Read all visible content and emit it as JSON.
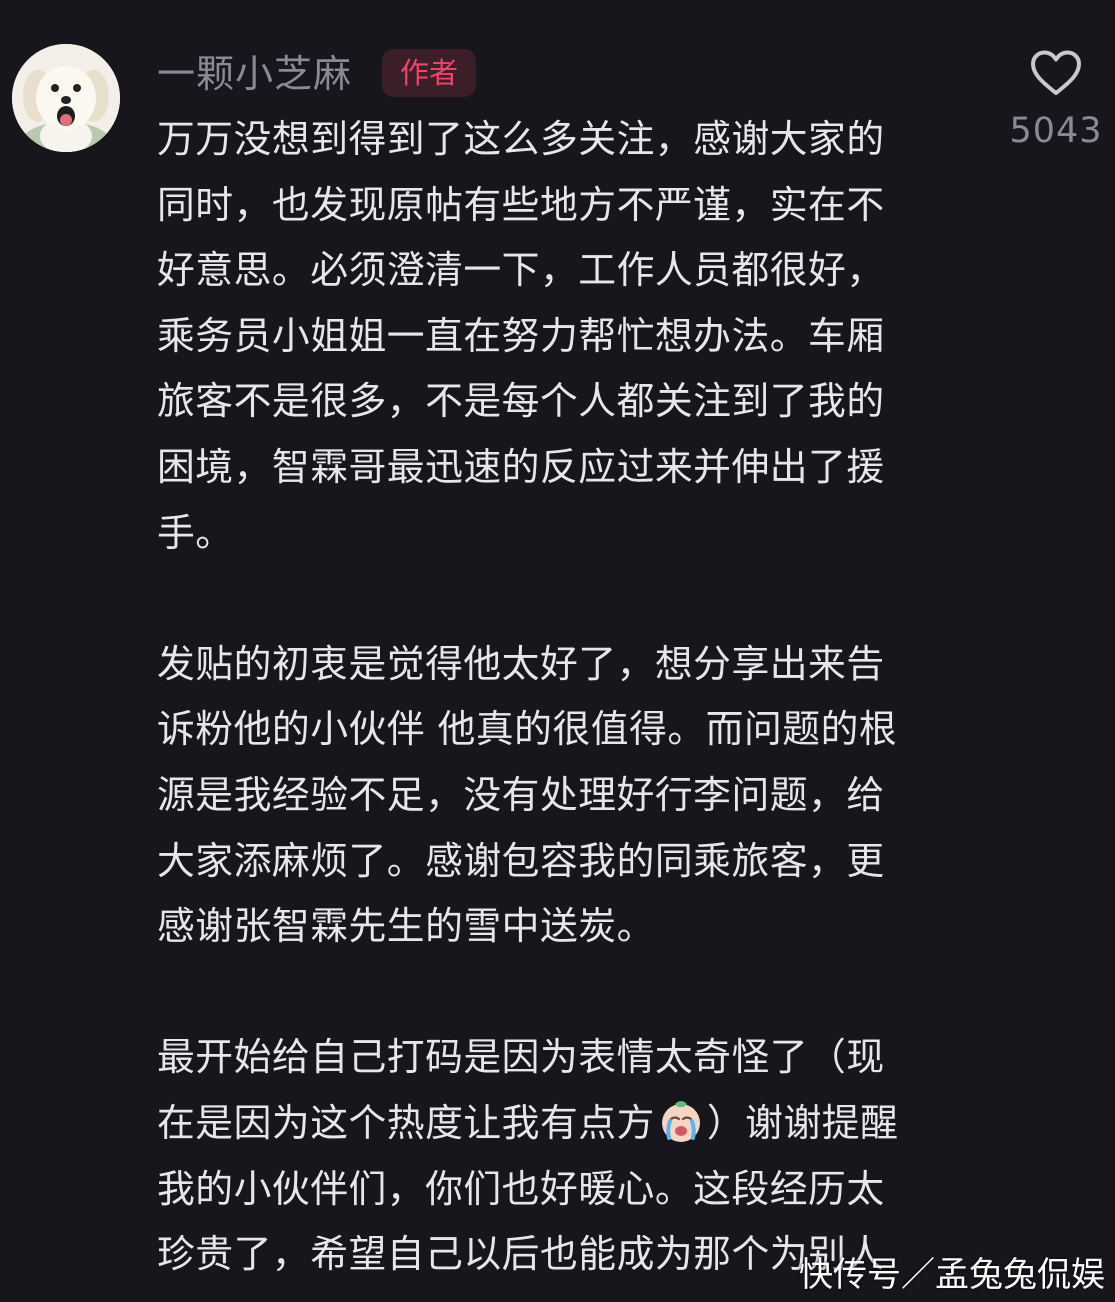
{
  "comment": {
    "username": "一颗小芝麻",
    "author_badge": "作者",
    "like_count": "5043",
    "avatar_icon": "dog-avatar-icon",
    "like_icon": "heart-outline-icon",
    "paragraphs": [
      {
        "lines": [
          "万万没想到得到了这么多关注，感谢大家的",
          "同时，也发现原帖有些地方不严谨，实在不",
          "好意思。必须澄清一下，工作人员都很好，",
          "乘务员小姐姐一直在努力帮忙想办法。车厢",
          "旅客不是很多，不是每个人都关注到了我的",
          "困境，智霖哥最迅速的反应过来并伸出了援",
          "手。"
        ]
      },
      {
        "lines": [
          "发贴的初衷是觉得他太好了，想分享出来告",
          "诉粉他的小伙伴 他真的很值得。而问题的根",
          "源是我经验不足，没有处理好行李问题，给",
          "大家添麻烦了。感谢包容我的同乘旅客，更",
          "感谢张智霖先生的雪中送炭。"
        ]
      },
      {
        "line1": "最开始给自己打码是因为表情太奇怪了（现",
        "line2_before": "在是因为这个热度让我有点方",
        "line2_emoji": "crying-face-icon",
        "line2_after": "）谢谢提醒",
        "line3": "我的小伙伴们，你们也好暖心。这段经历太",
        "line4": "珍贵了，希望自己以后也能成为那个为别人"
      }
    ]
  },
  "watermark": "快传号／孟兔兔侃娱"
}
